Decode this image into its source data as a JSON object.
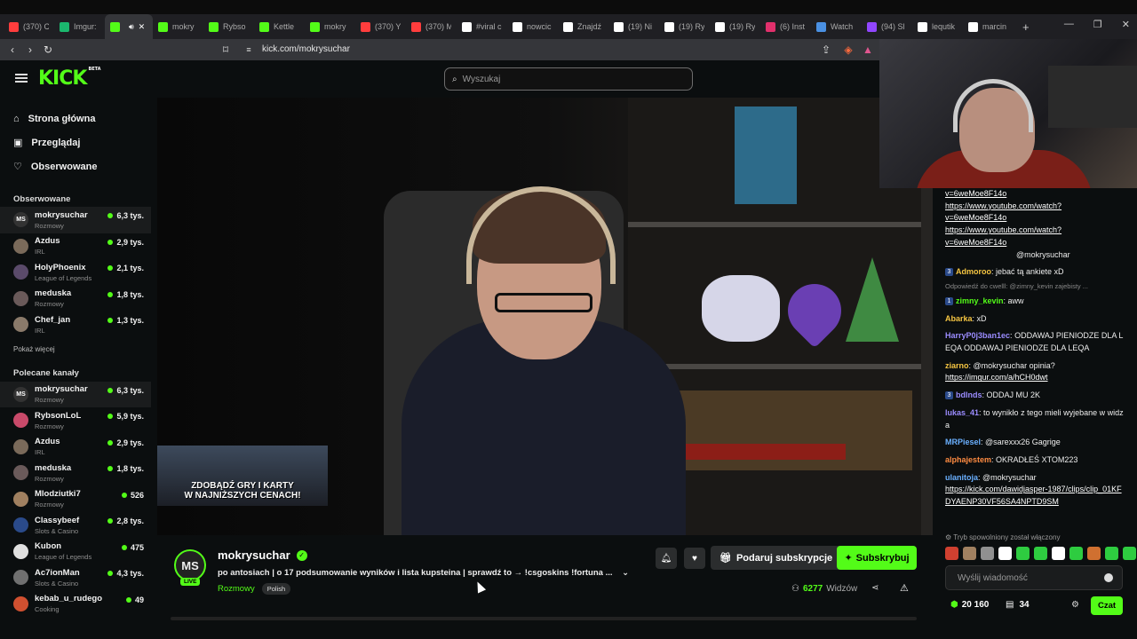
{
  "browser": {
    "tabs": [
      {
        "label": "(370) C",
        "color": "#ff3d3d",
        "icon": "youtube-icon"
      },
      {
        "label": "Imgur:",
        "color": "#1bb76e",
        "icon": "imgur-icon"
      },
      {
        "label": "",
        "color": "#53fc18",
        "icon": "kick-icon",
        "active": true
      },
      {
        "label": "mokry",
        "color": "#53fc18",
        "icon": "kick-icon"
      },
      {
        "label": "Rybso",
        "color": "#53fc18",
        "icon": "kick-icon"
      },
      {
        "label": "Kettle",
        "color": "#53fc18",
        "icon": "kick-icon"
      },
      {
        "label": "mokry",
        "color": "#53fc18",
        "icon": "kick-icon"
      },
      {
        "label": "(370) Y",
        "color": "#ff3d3d",
        "icon": "youtube-icon"
      },
      {
        "label": "(370) M",
        "color": "#ff3d3d",
        "icon": "youtube-icon"
      },
      {
        "label": "#viral c",
        "color": "#ffffff",
        "icon": "tiktok-icon"
      },
      {
        "label": "nowcic",
        "color": "#ffffff",
        "icon": "tiktok-icon"
      },
      {
        "label": "Znajdź",
        "color": "#ffffff",
        "icon": "tiktok-icon"
      },
      {
        "label": "(19) Ni",
        "color": "#ffffff",
        "icon": "x-icon"
      },
      {
        "label": "(19) Ry",
        "color": "#ffffff",
        "icon": "x-icon"
      },
      {
        "label": "(19) Ry",
        "color": "#ffffff",
        "icon": "x-icon"
      },
      {
        "label": "(6) Inst",
        "color": "#e1306c",
        "icon": "instagram-icon"
      },
      {
        "label": "Watch",
        "color": "#4a90e2",
        "icon": "watch-icon"
      },
      {
        "label": "(94) Sl",
        "color": "#9146ff",
        "icon": "twitch-icon"
      },
      {
        "label": "lequtik",
        "color": "#ffffff",
        "icon": "tiktok-icon"
      },
      {
        "label": "marcin",
        "color": "#ffffff",
        "icon": "google-icon"
      }
    ],
    "url": "kick.com/mokrysuchar"
  },
  "header": {
    "logo": "KICK",
    "logo_sup": "BETA",
    "search_placeholder": "Wyszukaj"
  },
  "sidebar": {
    "nav": [
      {
        "label": "Strona główna",
        "icon": "home-icon"
      },
      {
        "label": "Przeglądaj",
        "icon": "browse-icon"
      },
      {
        "label": "Obserwowane",
        "icon": "heart-icon"
      }
    ],
    "followed_title": "Obserwowane",
    "followed": [
      {
        "name": "mokrysuchar",
        "category": "Rozmowy",
        "viewers": "6,3 tys.",
        "avatar": "MS",
        "color": "#333"
      },
      {
        "name": "Azdus",
        "category": "IRL",
        "viewers": "2,9 tys.",
        "avatar": "",
        "color": "#7a6a5a"
      },
      {
        "name": "HolyPhoenix",
        "category": "League of Legends",
        "viewers": "2,1 tys.",
        "avatar": "",
        "color": "#5a4a6a"
      },
      {
        "name": "meduska",
        "category": "Rozmowy",
        "viewers": "1,8 tys.",
        "avatar": "",
        "color": "#6a5a5a"
      },
      {
        "name": "Chef_jan",
        "category": "IRL",
        "viewers": "1,3 tys.",
        "avatar": "",
        "color": "#8a7a6a"
      }
    ],
    "show_more": "Pokaż więcej",
    "recommended_title": "Polecane kanały",
    "recommended": [
      {
        "name": "mokrysuchar",
        "category": "Rozmowy",
        "viewers": "6,3 tys.",
        "avatar": "MS",
        "color": "#333"
      },
      {
        "name": "RybsonLoL",
        "category": "Rozmowy",
        "viewers": "5,9 tys.",
        "avatar": "",
        "color": "#c94a6a"
      },
      {
        "name": "Azdus",
        "category": "IRL",
        "viewers": "2,9 tys.",
        "avatar": "",
        "color": "#7a6a5a"
      },
      {
        "name": "meduska",
        "category": "Rozmowy",
        "viewers": "1,8 tys.",
        "avatar": "",
        "color": "#6a5a5a"
      },
      {
        "name": "Mlodziutki7",
        "category": "Rozmowy",
        "viewers": "526",
        "avatar": "",
        "color": "#a08060"
      },
      {
        "name": "Classybeef",
        "category": "Slots & Casino",
        "viewers": "2,8 tys.",
        "avatar": "",
        "color": "#2a4a8a"
      },
      {
        "name": "Kubon",
        "category": "League of Legends",
        "viewers": "475",
        "avatar": "",
        "color": "#e0e0e0"
      },
      {
        "name": "Ac7ionMan",
        "category": "Slots & Casino",
        "viewers": "4,3 tys.",
        "avatar": "",
        "color": "#707070"
      },
      {
        "name": "kebab_u_rudego",
        "category": "Cooking",
        "viewers": "49",
        "avatar": "",
        "color": "#d05030"
      }
    ]
  },
  "ad": {
    "line1": "ZDOBĄDŹ GRY I KARTY",
    "line2": "W NAJNIŻSZYCH CENACH!"
  },
  "stream": {
    "avatar": "MS",
    "live": "LIVE",
    "name": "mokrysuchar",
    "title": "po antosiach | o 17 podsumowanie wyników i lista kupsteina | sprawdź to → !csgoskins !fortuna ...",
    "category": "Rozmowy",
    "tag": "Polish",
    "gift_label": "Podaruj subskrypcje",
    "subscribe_label": "Subskrybuj",
    "viewers_count": "6277",
    "viewers_label": "Widzów"
  },
  "chat": {
    "messages": [
      {
        "user": "",
        "text": "",
        "links": [
          "v=6weMoe8F14o",
          "https://www.youtube.com/watch?",
          "v=6weMoe8F14o",
          "https://www.youtube.com/watch?",
          "v=6weMoe8F14o"
        ],
        "mention": "@mokrysuchar"
      },
      {
        "badge": "3",
        "user": "Admoroo",
        "color": "#f5c542",
        "text": "jebać tą ankiete xD"
      },
      {
        "reply": "Odpowiedź do cwelll: @zimny_kevin zajebisty ..."
      },
      {
        "badge": "1",
        "user": "zimny_kevin",
        "color": "#53fc18",
        "text": "aww"
      },
      {
        "user": "Abarka",
        "color": "#f5c542",
        "text": "xD"
      },
      {
        "user": "HarryP0j3ban1ec",
        "color": "#9b8cff",
        "text": "ODDAWAJ PIENIODZE DLA LEQA ODDAWAJ PIENIODZE DLA LEQA"
      },
      {
        "user": "ziarno",
        "color": "#f5c542",
        "text": "@mokrysuchar opinia?",
        "link": "https://imgur.com/a/hCH0dwt"
      },
      {
        "badge": "3",
        "user": "bdlnds",
        "color": "#9b8cff",
        "text": "ODDAJ MU 2K"
      },
      {
        "user": "lukas_41",
        "color": "#9b8cff",
        "text": "to wynikło z tego mieli wyjebane w widza"
      },
      {
        "user": "MRPiesel",
        "color": "#6ab0ff",
        "text": "@sarexxx26 Gagrige"
      },
      {
        "user": "alphajestem",
        "color": "#ff8c42",
        "text": "OKRADŁEŚ XTOM223"
      },
      {
        "user": "ulanitoja",
        "color": "#6ab0ff",
        "text": "@mokrysuchar",
        "link": "https://kick.com/dawidjasper-1987/clips/clip_01KFDYAENP30VF56SA4NPTD9SM"
      }
    ],
    "slow_mode": "Tryb spowolniony został włączony",
    "input_placeholder": "Wyślij wiadomość",
    "points": "20 160",
    "chest": "34",
    "send_label": "Czat"
  }
}
